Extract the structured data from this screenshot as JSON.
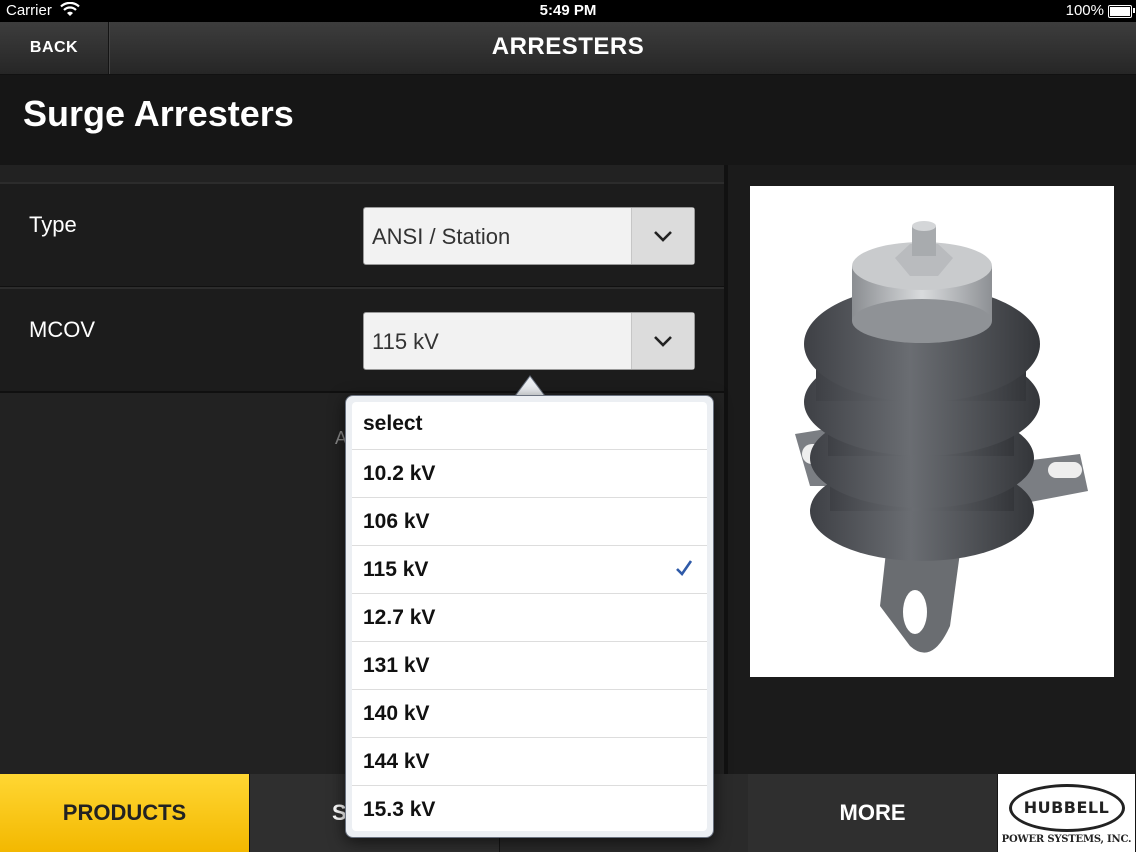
{
  "status_bar": {
    "carrier": "Carrier",
    "time": "5:49 PM",
    "battery": "100%"
  },
  "nav": {
    "back_label": "BACK",
    "title": "ARRESTERS"
  },
  "page": {
    "title": "Surge Arresters"
  },
  "form": {
    "type": {
      "label": "Type",
      "value": "ANSI / Station"
    },
    "mcov": {
      "label": "MCOV",
      "value": "115 kV"
    },
    "partially_hidden_text": "A"
  },
  "dropdown": {
    "options": [
      "select",
      "10.2 kV",
      "106 kV",
      "115 kV",
      "12.7 kV",
      "131 kV",
      "140 kV",
      "144 kV",
      "15.3 kV"
    ],
    "selected": "115 kV",
    "check_color": "#2f5aa8"
  },
  "tabs": {
    "products": "PRODUCTS",
    "s_partial": "S",
    "more": "MORE"
  },
  "logo": {
    "word": "HUBBELL",
    "sub": "POWER SYSTEMS, INC."
  },
  "colors": {
    "accent": "#f5c000",
    "background": "#1b1b1b"
  }
}
